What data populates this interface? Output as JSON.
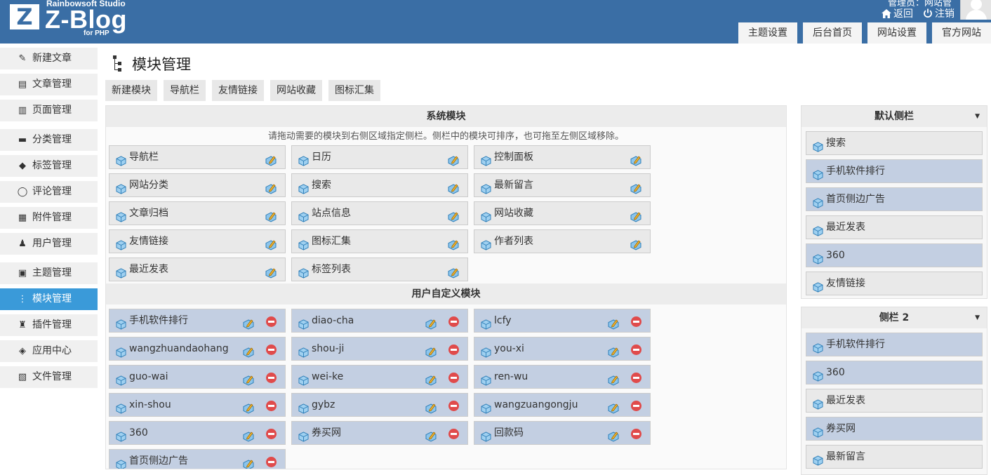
{
  "header": {
    "logo_letter": "Z",
    "logo_studio": "Rainbowsoft Studio",
    "logo_name": "Z-Blog",
    "logo_sub": "for PHP",
    "user_line": "管理员：网站管",
    "back_label": "返回",
    "logout_label": "注销",
    "tabs": [
      "主题设置",
      "后台首页",
      "网站设置",
      "官方网站"
    ],
    "brand_color": "#3a6ea5"
  },
  "sidebar": {
    "items": [
      {
        "label": "新建文章",
        "icon": "edit-icon",
        "glyph": "✎"
      },
      {
        "label": "文章管理",
        "icon": "document-icon",
        "glyph": "▤"
      },
      {
        "label": "页面管理",
        "icon": "pages-icon",
        "glyph": "▥"
      },
      {
        "label": "分类管理",
        "icon": "folder-icon",
        "glyph": "▬"
      },
      {
        "label": "标签管理",
        "icon": "tag-icon",
        "glyph": "◆"
      },
      {
        "label": "评论管理",
        "icon": "comment-icon",
        "glyph": "◯"
      },
      {
        "label": "附件管理",
        "icon": "attachment-icon",
        "glyph": "▦"
      },
      {
        "label": "用户管理",
        "icon": "user-icon",
        "glyph": "♟"
      },
      {
        "label": "主题管理",
        "icon": "theme-icon",
        "glyph": "▣"
      },
      {
        "label": "模块管理",
        "icon": "module-icon",
        "glyph": "⋮"
      },
      {
        "label": "插件管理",
        "icon": "plugin-icon",
        "glyph": "♜"
      },
      {
        "label": "应用中心",
        "icon": "app-center-icon",
        "glyph": "◈"
      },
      {
        "label": "文件管理",
        "icon": "file-icon",
        "glyph": "▧"
      }
    ],
    "active_index": 9,
    "active_color": "#3a9ad9"
  },
  "main": {
    "title": "模块管理",
    "sub_tabs": [
      "新建模块",
      "导航栏",
      "友情链接",
      "网站收藏",
      "图标汇集"
    ],
    "system_section_title": "系统模块",
    "hint": "请拖动需要的模块到右侧区域指定侧栏。侧栏中的模块可排序，也可拖至左侧区域移除。",
    "system_modules": [
      "导航栏",
      "日历",
      "控制面板",
      "网站分类",
      "搜索",
      "最新留言",
      "文章归档",
      "站点信息",
      "网站收藏",
      "友情链接",
      "图标汇集",
      "作者列表",
      "最近发表",
      "标签列表"
    ],
    "user_section_title": "用户自定义模块",
    "user_modules": [
      "手机软件排行",
      "diao-cha",
      "lcfy",
      "wangzhuandaohang",
      "shou-ji",
      "you-xi",
      "guo-wai",
      "wei-ke",
      "ren-wu",
      "xin-shou",
      "gybz",
      "wangzuangongju",
      "360",
      "券买网",
      "回款码",
      "首页侧边广告"
    ],
    "user_module_color": "#c3cfe2"
  },
  "sidebars": [
    {
      "title": "默认侧栏",
      "modules": [
        {
          "label": "搜索",
          "user": false
        },
        {
          "label": "手机软件排行",
          "user": true
        },
        {
          "label": "首页侧边广告",
          "user": true
        },
        {
          "label": "最近发表",
          "user": false
        },
        {
          "label": "360",
          "user": true
        },
        {
          "label": "友情链接",
          "user": false
        }
      ]
    },
    {
      "title": "侧栏 2",
      "modules": [
        {
          "label": "手机软件排行",
          "user": true
        },
        {
          "label": "360",
          "user": true
        },
        {
          "label": "最近发表",
          "user": false
        },
        {
          "label": "券买网",
          "user": true
        },
        {
          "label": "最新留言",
          "user": false
        }
      ]
    }
  ]
}
